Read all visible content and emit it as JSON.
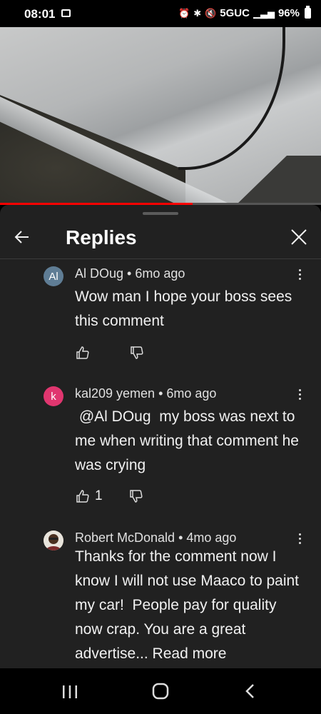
{
  "status_bar": {
    "time": "08:01",
    "network": "5GUC",
    "battery": "96%"
  },
  "video": {
    "progress_percent": 60
  },
  "panel": {
    "title": "Replies"
  },
  "comments": [
    {
      "avatar_text": "Al",
      "avatar_color": "#5f7d95",
      "meta": "Al DOug • 6mo ago",
      "body": "Wow man I hope your boss sees this comment",
      "likes": ""
    },
    {
      "avatar_text": "k",
      "avatar_color": "#e0366f",
      "meta": "kal209 yemen • 6mo ago",
      "body": " @Al DOug  my boss was next to me when writing that comment he was crying",
      "likes": "1"
    },
    {
      "avatar_text": "",
      "avatar_color": "#6b4a2e",
      "meta": "Robert McDonald • 4mo ago",
      "body": "Thanks for the comment now I know I will not use Maaco to paint my car!  People pay for quality now crap. You are a great advertise... Read more",
      "likes": ""
    }
  ],
  "colors": {
    "accent": "#ff0000",
    "panel_bg": "#212121"
  }
}
